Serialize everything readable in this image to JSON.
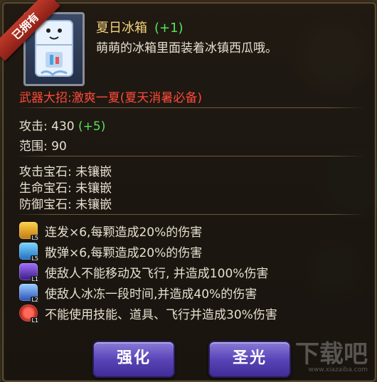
{
  "badge": {
    "owned": "已拥有"
  },
  "item": {
    "name": "夏日冰箱",
    "level": "(+1)",
    "description": "萌萌的冰箱里面装着冰镇西瓜哦。",
    "ultimate": "武器大招:激爽一夏(夏天消暑必备)"
  },
  "stats": {
    "attack_label": "攻击:",
    "attack_value": "430",
    "attack_bonus": "(+5)",
    "range_label": "范围:",
    "range_value": "90"
  },
  "gems": [
    {
      "label": "攻击宝石:",
      "value": "未镶嵌"
    },
    {
      "label": "生命宝石:",
      "value": "未镶嵌"
    },
    {
      "label": "防御宝石:",
      "value": "未镶嵌"
    }
  ],
  "effects": [
    {
      "icon": "gold-multishot-icon",
      "level": "L5",
      "color": "#e0a41c",
      "text": "连发×6,每颗造成20%的伤害"
    },
    {
      "icon": "blue-scatter-icon",
      "level": "L5",
      "color": "#2f9fe0",
      "text": "散弹×6,每颗造成20%的伤害"
    },
    {
      "icon": "purple-star-icon",
      "level": "L1",
      "color": "#6a3ab8",
      "text": "使敌人不能移动及飞行, 并造成100%伤害"
    },
    {
      "icon": "ice-freeze-icon",
      "level": "L2",
      "color": "#3b6fd8",
      "text": "使敌人冰冻一段时间,并造成40%的伤害"
    },
    {
      "icon": "red-silence-icon",
      "level": "L1",
      "color": "#c42a1e",
      "text": "不能使用技能、道具、飞行并造成30%伤害"
    }
  ],
  "buttons": {
    "enhance": "强化",
    "holy_light": "圣光"
  },
  "watermark": {
    "brand": "下载吧",
    "url": "www.xiazaiba.com"
  }
}
